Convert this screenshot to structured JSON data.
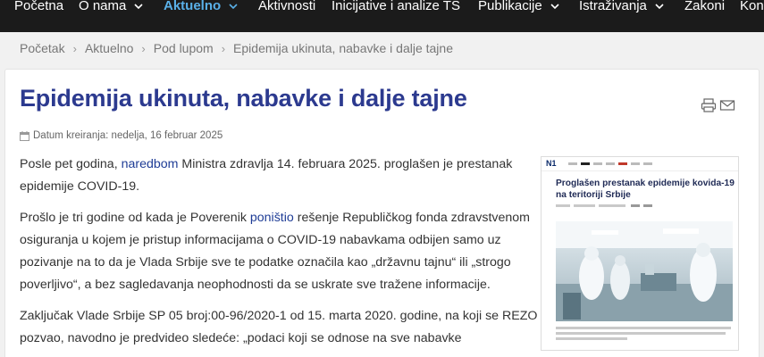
{
  "nav": {
    "items": [
      {
        "label": "Početna",
        "has_dropdown": false,
        "active": false
      },
      {
        "label": "O nama",
        "has_dropdown": true,
        "active": false
      },
      {
        "label": "Aktuelno",
        "has_dropdown": true,
        "active": true
      },
      {
        "label": "Aktivnosti",
        "has_dropdown": false,
        "active": false
      },
      {
        "label": "Inicijative i analize TS",
        "has_dropdown": false,
        "active": false
      },
      {
        "label": "Publikacije",
        "has_dropdown": true,
        "active": false
      },
      {
        "label": "Istraživanja",
        "has_dropdown": true,
        "active": false
      },
      {
        "label": "Zakoni",
        "has_dropdown": false,
        "active": false
      },
      {
        "label": "Kon",
        "has_dropdown": false,
        "active": false
      }
    ],
    "colors": {
      "background": "#1b1b1b",
      "text": "#ffffff",
      "active": "#5ab0e8"
    }
  },
  "breadcrumb": {
    "items": [
      "Početak",
      "Aktuelno",
      "Pod lupom",
      "Epidemija ukinuta, nabavke i dalje tajne"
    ],
    "separator": "›"
  },
  "article": {
    "title": "Epidemija ukinuta, nabavke i dalje tajne",
    "date": "Datum kreiranja: nedelja, 16 februar 2025",
    "icons": [
      "calendar-icon",
      "print-icon",
      "email-icon"
    ],
    "paragraphs": [
      {
        "before": "Posle pet godina, ",
        "link": "naredbom",
        "after": " Ministra zdravlja 14. februara 2025. proglašen je prestanak epidemije COVID-19."
      },
      {
        "before": "Prošlo je tri godine od kada je Poverenik ",
        "link": "poništio",
        "after": " rešenje Republičkog fonda zdravstvenom osiguranja u kojem je pristup informacijama o COVID-19 nabavkama odbijen samo uz pozivanje na to da je Vlada Srbije sve te podatke označila kao „državnu tajnu“ ili „strogo poverljivo“, a bez sagledavanja neophodnosti da se uskrate sve tražene informacije."
      },
      {
        "before": "Zaključak Vlade Srbije SP 05 broj:00-96/2020-1 od 15. marta 2020. godine, na koji se REZO pozvao, navodno je predvideo sledeće: „podaci koji se odnose na sve nabavke",
        "link": "",
        "after": ""
      }
    ],
    "link_color": "#1f3d96",
    "title_color": "#2c3a8f"
  },
  "thumbnail": {
    "logo": "N1",
    "headline": "Proglašen prestanak epidemije kovida-19 na teritoriji Srbije"
  }
}
